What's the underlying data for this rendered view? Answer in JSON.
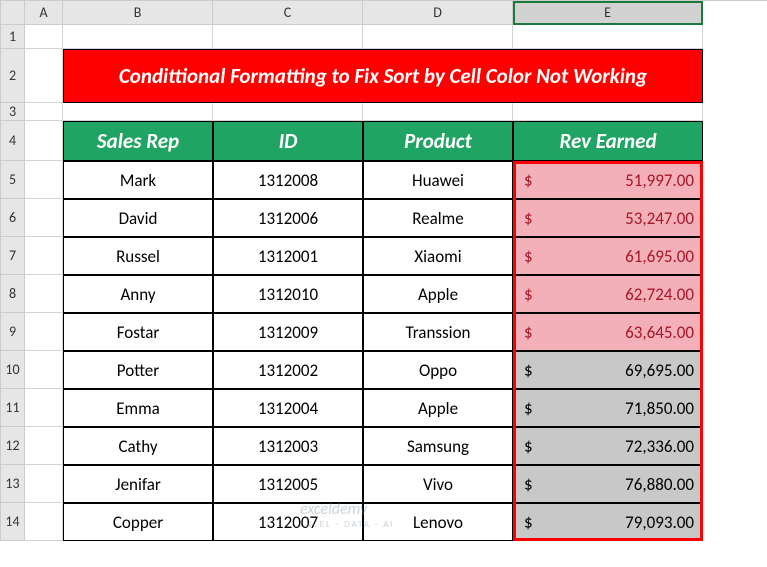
{
  "columns": [
    "A",
    "B",
    "C",
    "D",
    "E"
  ],
  "rows": [
    "1",
    "2",
    "3",
    "4",
    "5",
    "6",
    "7",
    "8",
    "9",
    "10",
    "11",
    "12",
    "13",
    "14"
  ],
  "title": "Condittional Formatting to Fix Sort by Cell Color Not Working",
  "headers": {
    "rep": "Sales Rep",
    "id": "ID",
    "product": "Product",
    "rev": "Rev Earned"
  },
  "data_rows": [
    {
      "rep": "Mark",
      "id": "1312008",
      "product": "Huawei",
      "rev": "51,997.00",
      "highlight": "red"
    },
    {
      "rep": "David",
      "id": "1312006",
      "product": "Realme",
      "rev": "53,247.00",
      "highlight": "red"
    },
    {
      "rep": "Russel",
      "id": "1312001",
      "product": "Xiaomi",
      "rev": "61,695.00",
      "highlight": "red"
    },
    {
      "rep": "Anny",
      "id": "1312010",
      "product": "Apple",
      "rev": "62,724.00",
      "highlight": "red"
    },
    {
      "rep": "Fostar",
      "id": "1312009",
      "product": "Transsion",
      "rev": "63,645.00",
      "highlight": "red"
    },
    {
      "rep": "Potter",
      "id": "1312002",
      "product": "Oppo",
      "rev": "69,695.00",
      "highlight": "gray"
    },
    {
      "rep": "Emma",
      "id": "1312004",
      "product": "Apple",
      "rev": "71,850.00",
      "highlight": "gray"
    },
    {
      "rep": "Cathy",
      "id": "1312003",
      "product": "Samsung",
      "rev": "72,336.00",
      "highlight": "gray"
    },
    {
      "rep": "Jenifar",
      "id": "1312005",
      "product": "Vivo",
      "rev": "76,880.00",
      "highlight": "gray"
    },
    {
      "rep": "Copper",
      "id": "1312007",
      "product": "Lenovo",
      "rev": "79,093.00",
      "highlight": "gray"
    }
  ],
  "currency": "$",
  "watermark": {
    "main": "exceldemy",
    "sub": "EXCEL · DATA · AI"
  }
}
